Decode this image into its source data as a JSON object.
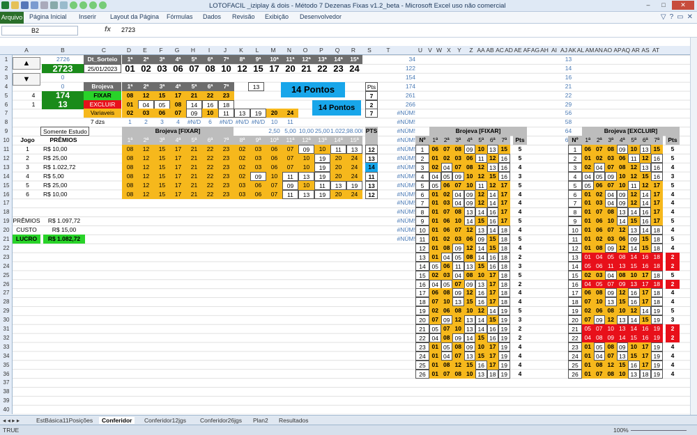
{
  "window": {
    "title": "LOTOFACIL _iziplay & dois - Método 7 Dezenas Fixas v1.2_beta - Microsoft Excel uso não comercial"
  },
  "ribbon": {
    "file": "Arquivo",
    "tabs": [
      "Página Inicial",
      "Inserir",
      "Layout da Página",
      "Fórmulas",
      "Dados",
      "Revisão",
      "Exibição",
      "Desenvolvedor"
    ]
  },
  "formula": {
    "name_box": "B2",
    "fx": "fx",
    "value": "2723"
  },
  "columns": [
    "A",
    "B",
    "C",
    "D",
    "E",
    "F",
    "G",
    "H",
    "I",
    "J",
    "K",
    "L",
    "M",
    "N",
    "O",
    "P",
    "Q",
    "R",
    "S",
    "T",
    "U",
    "V",
    "W",
    "X",
    "Y",
    "Z",
    "AA",
    "AB",
    "AC",
    "AD",
    "AE",
    "AF",
    "AG",
    "AH",
    "AI",
    "AJ",
    "AK",
    "AL",
    "AM",
    "AN",
    "AO",
    "AP",
    "AQ",
    "AR",
    "AS",
    "AT"
  ],
  "header": {
    "prev_contest": "2726",
    "contest": "2723",
    "dt_label": "Dt_Sorteio",
    "date": "25/01/2023",
    "pos_labels": [
      "1ª",
      "2ª",
      "3ª",
      "4ª",
      "5ª",
      "6ª",
      "7ª",
      "8ª",
      "9ª",
      "10ª",
      "11ª",
      "12ª",
      "13ª",
      "14ª",
      "15ª"
    ],
    "draw": [
      "01",
      "02",
      "03",
      "06",
      "07",
      "08",
      "10",
      "12",
      "15",
      "17",
      "20",
      "21",
      "22",
      "23",
      "24"
    ]
  },
  "left": {
    "zero1": "0",
    "zero2": "0",
    "spin1": "4",
    "spin2": "1",
    "big1": "174",
    "big2": "13",
    "num13": "13",
    "somente": "Somente Estudo",
    "jogo": "Jogo",
    "premios": "PRÊMIOS",
    "dz7": "7 dzs"
  },
  "brojeva": {
    "title": "Brojeva",
    "pts": "Pts",
    "fixar": {
      "label": "FIXAR",
      "nums": [
        "08",
        "12",
        "15",
        "17",
        "21",
        "22",
        "23"
      ],
      "pts": "7"
    },
    "excluir": {
      "label": "EXCLUIR",
      "nums": [
        "01",
        "04",
        "05",
        "08",
        "14",
        "16",
        "18"
      ],
      "pts": "2"
    },
    "variaveis": {
      "label": "Variaveis",
      "nums": [
        "02",
        "03",
        "06",
        "07",
        "09",
        "10",
        "11",
        "13",
        "19",
        "20",
        "24"
      ],
      "pts": "7"
    },
    "row8": [
      "1",
      "2",
      "3",
      "4",
      "#N/D",
      "6",
      "#N/D",
      "#N/D",
      "#N/D",
      "10",
      "11"
    ],
    "row9": [
      "2,50",
      "5,00",
      "10,00",
      "25,00",
      "1.022,72",
      "98.000,0"
    ],
    "p14a": "14 Pontos",
    "p14b": "14 Pontos",
    "fixar_header": "Brojeva [FIXAR]",
    "pts_header": "PTS"
  },
  "games": [
    {
      "n": "1",
      "prize": "R$      10,00",
      "nums": [
        "08",
        "12",
        "15",
        "17",
        "21",
        "22",
        "23",
        "02",
        "03",
        "06",
        "07",
        "09",
        "10",
        "11",
        "13"
      ],
      "pts": "12"
    },
    {
      "n": "2",
      "prize": "R$      25,00",
      "nums": [
        "08",
        "12",
        "15",
        "17",
        "21",
        "22",
        "23",
        "02",
        "03",
        "06",
        "07",
        "10",
        "19",
        "20",
        "24"
      ],
      "pts": "13"
    },
    {
      "n": "3",
      "prize": "R$ 1.022,72",
      "nums": [
        "08",
        "12",
        "15",
        "17",
        "21",
        "22",
        "23",
        "02",
        "03",
        "06",
        "07",
        "10",
        "19",
        "20",
        "24"
      ],
      "pts": "14"
    },
    {
      "n": "4",
      "prize": "R$        5,00",
      "nums": [
        "08",
        "12",
        "15",
        "17",
        "21",
        "22",
        "23",
        "02",
        "09",
        "10",
        "11",
        "13",
        "19",
        "20",
        "24"
      ],
      "pts": "11"
    },
    {
      "n": "5",
      "prize": "R$      25,00",
      "nums": [
        "08",
        "12",
        "15",
        "17",
        "21",
        "22",
        "23",
        "03",
        "06",
        "07",
        "09",
        "10",
        "11",
        "13",
        "19"
      ],
      "pts": "13"
    },
    {
      "n": "6",
      "prize": "R$      10,00",
      "nums": [
        "08",
        "12",
        "15",
        "17",
        "21",
        "22",
        "23",
        "03",
        "06",
        "07",
        "11",
        "13",
        "19",
        "20",
        "24"
      ],
      "pts": "12"
    }
  ],
  "summary": {
    "premios_l": "PRÊMIOS",
    "premios_v": "R$ 1.097,72",
    "custo_l": "CUSTO",
    "custo_v": "R$      15,00",
    "lucro_l": "LUCRO",
    "lucro_v": "R$ 1.082,72"
  },
  "ucol": [
    "34",
    "122",
    "154",
    "174",
    "261",
    "266",
    "#NÚM!",
    "#NÚM!",
    "#NÚM!",
    "#NÚM!",
    "#NÚM!",
    "#NÚM!",
    "#NÚM!",
    "#NÚM!",
    "#NÚM!",
    "#NÚM!",
    "#NÚM!",
    "#NÚM!",
    "#NÚM!",
    "#NÚM!",
    "#NÚM!"
  ],
  "ajcol": [
    "13",
    "14",
    "16",
    "21",
    "22",
    "29",
    "56",
    "58",
    "64",
    "65"
  ],
  "fixar_table": {
    "title": "Brojeva [FIXAR]",
    "no": "Nº",
    "pts": "Pts",
    "rows": [
      [
        "1",
        "06",
        "07",
        "08",
        "09",
        "10",
        "13",
        "15",
        "5"
      ],
      [
        "2",
        "01",
        "02",
        "03",
        "06",
        "11",
        "12",
        "16",
        "5"
      ],
      [
        "3",
        "02",
        "04",
        "07",
        "08",
        "12",
        "13",
        "16",
        "4"
      ],
      [
        "4",
        "04",
        "05",
        "09",
        "10",
        "12",
        "15",
        "16",
        "3"
      ],
      [
        "5",
        "05",
        "06",
        "07",
        "10",
        "11",
        "12",
        "17",
        "5"
      ],
      [
        "6",
        "01",
        "02",
        "04",
        "09",
        "12",
        "14",
        "17",
        "4"
      ],
      [
        "7",
        "01",
        "03",
        "04",
        "09",
        "12",
        "14",
        "17",
        "4"
      ],
      [
        "8",
        "01",
        "07",
        "08",
        "13",
        "14",
        "16",
        "17",
        "4"
      ],
      [
        "9",
        "01",
        "06",
        "10",
        "14",
        "15",
        "16",
        "17",
        "5"
      ],
      [
        "10",
        "01",
        "06",
        "07",
        "12",
        "13",
        "14",
        "18",
        "4"
      ],
      [
        "11",
        "01",
        "02",
        "03",
        "06",
        "09",
        "15",
        "18",
        "5"
      ],
      [
        "12",
        "01",
        "08",
        "09",
        "12",
        "14",
        "15",
        "18",
        "4"
      ],
      [
        "13",
        "01",
        "04",
        "05",
        "08",
        "14",
        "16",
        "18",
        "2"
      ],
      [
        "14",
        "05",
        "06",
        "11",
        "13",
        "15",
        "16",
        "18",
        "3"
      ],
      [
        "15",
        "02",
        "03",
        "04",
        "08",
        "10",
        "17",
        "18",
        "5"
      ],
      [
        "16",
        "04",
        "05",
        "07",
        "09",
        "13",
        "17",
        "18",
        "2"
      ],
      [
        "17",
        "06",
        "08",
        "09",
        "12",
        "16",
        "17",
        "18",
        "4"
      ],
      [
        "18",
        "07",
        "10",
        "13",
        "15",
        "16",
        "17",
        "18",
        "4"
      ],
      [
        "19",
        "02",
        "06",
        "08",
        "10",
        "12",
        "14",
        "19",
        "5"
      ],
      [
        "20",
        "07",
        "09",
        "12",
        "13",
        "14",
        "15",
        "19",
        "3"
      ],
      [
        "21",
        "05",
        "07",
        "10",
        "13",
        "14",
        "16",
        "19",
        "2"
      ],
      [
        "22",
        "04",
        "08",
        "09",
        "14",
        "15",
        "16",
        "19",
        "2"
      ],
      [
        "23",
        "01",
        "05",
        "08",
        "09",
        "10",
        "17",
        "19",
        "4"
      ],
      [
        "24",
        "01",
        "04",
        "07",
        "13",
        "15",
        "17",
        "19",
        "4"
      ],
      [
        "25",
        "01",
        "08",
        "12",
        "15",
        "16",
        "17",
        "19",
        "4"
      ],
      [
        "26",
        "01",
        "07",
        "08",
        "10",
        "13",
        "18",
        "19",
        "4"
      ]
    ]
  },
  "excluir_table": {
    "title": "Brojeva [EXCLUIR]",
    "no": "Nº",
    "pts": "Pts",
    "rows": [
      [
        "1",
        "06",
        "07",
        "08",
        "09",
        "10",
        "13",
        "15",
        "5"
      ],
      [
        "2",
        "01",
        "02",
        "03",
        "06",
        "11",
        "12",
        "16",
        "5"
      ],
      [
        "3",
        "02",
        "04",
        "07",
        "08",
        "12",
        "13",
        "16",
        "4"
      ],
      [
        "4",
        "04",
        "05",
        "09",
        "10",
        "12",
        "15",
        "16",
        "3"
      ],
      [
        "5",
        "05",
        "06",
        "07",
        "10",
        "11",
        "12",
        "17",
        "5"
      ],
      [
        "6",
        "01",
        "02",
        "04",
        "09",
        "12",
        "14",
        "17",
        "4"
      ],
      [
        "7",
        "01",
        "03",
        "04",
        "09",
        "12",
        "14",
        "17",
        "4"
      ],
      [
        "8",
        "01",
        "07",
        "08",
        "13",
        "14",
        "16",
        "17",
        "4"
      ],
      [
        "9",
        "01",
        "06",
        "10",
        "14",
        "15",
        "16",
        "17",
        "5"
      ],
      [
        "10",
        "01",
        "06",
        "07",
        "12",
        "13",
        "14",
        "18",
        "4"
      ],
      [
        "11",
        "01",
        "02",
        "03",
        "06",
        "09",
        "15",
        "18",
        "5"
      ],
      [
        "12",
        "01",
        "08",
        "09",
        "12",
        "14",
        "15",
        "18",
        "4"
      ],
      [
        "13",
        "01",
        "04",
        "05",
        "08",
        "14",
        "16",
        "18",
        "2"
      ],
      [
        "14",
        "05",
        "06",
        "11",
        "13",
        "15",
        "16",
        "18",
        "2"
      ],
      [
        "15",
        "02",
        "03",
        "04",
        "08",
        "10",
        "17",
        "18",
        "5"
      ],
      [
        "16",
        "04",
        "05",
        "07",
        "09",
        "13",
        "17",
        "18",
        "2"
      ],
      [
        "17",
        "06",
        "08",
        "09",
        "12",
        "16",
        "17",
        "18",
        "4"
      ],
      [
        "18",
        "07",
        "10",
        "13",
        "15",
        "16",
        "17",
        "18",
        "4"
      ],
      [
        "19",
        "02",
        "06",
        "08",
        "10",
        "12",
        "14",
        "19",
        "5"
      ],
      [
        "20",
        "07",
        "09",
        "12",
        "13",
        "14",
        "15",
        "19",
        "3"
      ],
      [
        "21",
        "05",
        "07",
        "10",
        "13",
        "14",
        "16",
        "19",
        "2"
      ],
      [
        "22",
        "04",
        "08",
        "09",
        "14",
        "15",
        "16",
        "19",
        "2"
      ],
      [
        "23",
        "01",
        "05",
        "08",
        "09",
        "10",
        "17",
        "19",
        "4"
      ],
      [
        "24",
        "01",
        "04",
        "07",
        "13",
        "15",
        "17",
        "19",
        "4"
      ],
      [
        "25",
        "01",
        "08",
        "12",
        "15",
        "16",
        "17",
        "19",
        "4"
      ],
      [
        "26",
        "01",
        "07",
        "08",
        "10",
        "13",
        "18",
        "19",
        "4"
      ]
    ]
  },
  "sheets": [
    "EstBásica11Posições",
    "Conferidor",
    "Conferidor12jgs",
    "Conferidor26jgs",
    "Plan2",
    "Resultados"
  ],
  "status": {
    "mode": "TRUE",
    "zoom": "100%"
  }
}
